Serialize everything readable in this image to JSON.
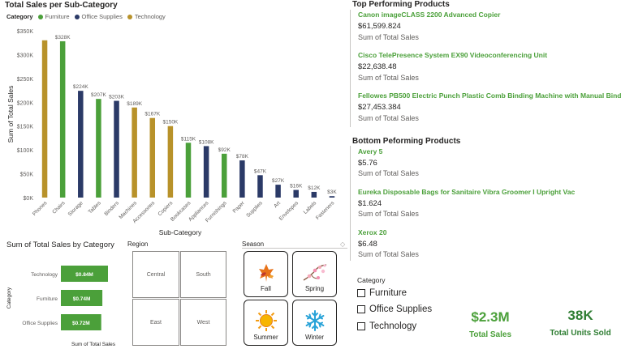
{
  "colors": {
    "furniture": "#4ba03a",
    "office_supplies": "#2b3a67",
    "technology": "#b8922a",
    "accent_green": "#4ba03a",
    "units_green": "#2e7d32"
  },
  "bar_chart": {
    "title": "Total Sales per Sub-Category",
    "legend_title": "Category",
    "legend": [
      {
        "name": "Furniture",
        "color": "#4ba03a"
      },
      {
        "name": "Office Supplies",
        "color": "#2b3a67"
      },
      {
        "name": "Technology",
        "color": "#b8922a"
      }
    ],
    "xlabel": "Sub-Category",
    "ylabel": "Sum of Total Sales"
  },
  "cat_chart": {
    "title": "Sum of Total Sales by Category",
    "ylabel": "Category",
    "xlabel": "Sum of Total Sales"
  },
  "chart_data": [
    {
      "type": "bar",
      "title": "Total Sales per Sub-Category",
      "xlabel": "Sub-Category",
      "ylabel": "Sum of Total Sales",
      "ylim": [
        0,
        350000
      ],
      "yticks": [
        "$0K",
        "$50K",
        "$100K",
        "$150K",
        "$200K",
        "$250K",
        "$300K",
        "$350K"
      ],
      "grid": false,
      "legend_position": "top-left",
      "categories": [
        "Phones",
        "Chairs",
        "Storage",
        "Tables",
        "Binders",
        "Machines",
        "Accessories",
        "Copiers",
        "Bookcases",
        "Appliances",
        "Furnishings",
        "Paper",
        "Supplies",
        "Art",
        "Envelopes",
        "Labels",
        "Fasteners"
      ],
      "values": [
        330000,
        328000,
        224000,
        207000,
        203000,
        189000,
        167000,
        150000,
        115000,
        108000,
        92000,
        78000,
        47000,
        27000,
        16000,
        12000,
        3000
      ],
      "labels": [
        "",
        "$328K",
        "$224K",
        "$207K",
        "$203K",
        "$189K",
        "$167K",
        "$150K",
        "$115K",
        "$108K",
        "$92K",
        "$78K",
        "$47K",
        "$27K",
        "$16K",
        "$12K",
        "$3K"
      ],
      "category_group": [
        "Technology",
        "Furniture",
        "Office Supplies",
        "Furniture",
        "Office Supplies",
        "Technology",
        "Technology",
        "Technology",
        "Furniture",
        "Office Supplies",
        "Furniture",
        "Office Supplies",
        "Office Supplies",
        "Office Supplies",
        "Office Supplies",
        "Office Supplies",
        "Office Supplies"
      ]
    },
    {
      "type": "bar",
      "orientation": "horizontal",
      "title": "Sum of Total Sales by Category",
      "xlabel": "Sum of Total Sales",
      "ylabel": "Category",
      "categories": [
        "Technology",
        "Furniture",
        "Office Supplies"
      ],
      "values": [
        0.84,
        0.74,
        0.72
      ],
      "labels": [
        "$0.84M",
        "$0.74M",
        "$0.72M"
      ],
      "color": "#4ba03a"
    }
  ],
  "slicers": {
    "region": {
      "title": "Region",
      "tiles": [
        "Central",
        "South",
        "East",
        "West"
      ]
    },
    "season": {
      "title": "Season",
      "tiles": [
        "Fall",
        "Spring",
        "Summer",
        "Winter"
      ]
    }
  },
  "top_products": {
    "title": "Top Performing Products",
    "items": [
      {
        "name": "Canon imageCLASS 2200 Advanced Copier",
        "value": "$61,599.824",
        "caption": "Sum of Total Sales"
      },
      {
        "name": "Cisco TelePresence System EX90 Videoconferencing Unit",
        "value": "$22,638.48",
        "caption": "Sum of Total Sales"
      },
      {
        "name": "Fellowes PB500 Electric Punch Plastic Comb Binding Machine with Manual Bind",
        "value": "$27,453.384",
        "caption": "Sum of Total Sales"
      }
    ]
  },
  "bottom_products": {
    "title": "Bottom Peforming Products",
    "items": [
      {
        "name": "Avery 5",
        "value": "$5.76",
        "caption": "Sum of Total Sales"
      },
      {
        "name": "Eureka Disposable Bags for Sanitaire Vibra Groomer I Upright Vac",
        "value": "$1.624",
        "caption": "Sum of Total Sales"
      },
      {
        "name": "Xerox 20",
        "value": "$6.48",
        "caption": "Sum of Total Sales"
      }
    ]
  },
  "category_filter": {
    "title": "Category",
    "options": [
      "Furniture",
      "Office Supplies",
      "Technology"
    ]
  },
  "kpis": {
    "sales_value": "$2.3M",
    "sales_label": "Total Sales",
    "units_value": "38K",
    "units_label": "Total Units Sold"
  }
}
